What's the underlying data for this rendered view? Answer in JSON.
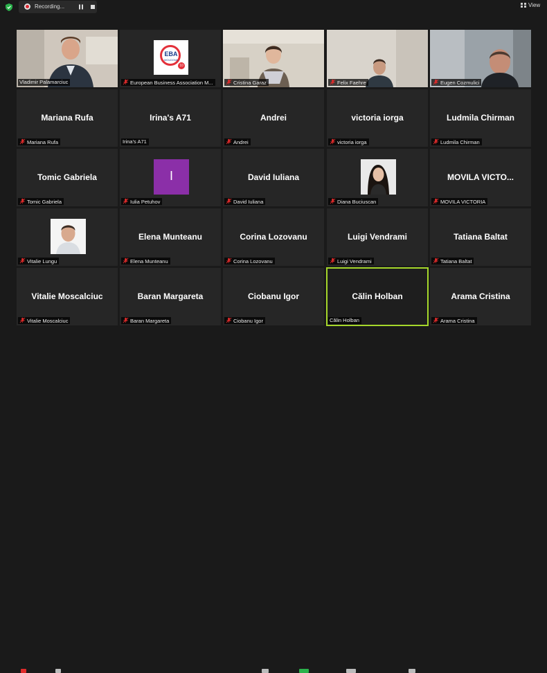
{
  "topbar": {
    "recording_label": "Recording...",
    "view_label": "View",
    "icons": [
      "security-shield-icon",
      "recording-icon",
      "pause-icon",
      "stop-icon",
      "grid-view-icon"
    ]
  },
  "colors": {
    "background": "#1a1a1a",
    "tile": "#262626",
    "active_speaker_border": "#a6d82b",
    "muted_icon": "#e02b2b",
    "security_shield": "#2bb24c",
    "avatar_purple": "#8b2fa8"
  },
  "participants": [
    {
      "display": "Vladimir Palamarciuc",
      "label": "Vladimir Palamarciuc",
      "muted": false,
      "media": "video"
    },
    {
      "display": "European Business Association M...",
      "label": "European Business Association M...",
      "muted": true,
      "media": "logo",
      "logo_text": "EBA",
      "logo_sub": "MOLDOVA",
      "logo_badge": "10"
    },
    {
      "display": "Cristina Garaz",
      "label": "Cristina Garaz",
      "muted": true,
      "media": "video"
    },
    {
      "display": "Felix Faehre",
      "label": "Felix Faehre",
      "muted": true,
      "media": "video"
    },
    {
      "display": "Eugen Cozmulici",
      "label": "Eugen Cozmulici",
      "muted": true,
      "media": "video"
    },
    {
      "display": "Mariana Rufa",
      "label": "Mariana Rufa",
      "muted": true,
      "media": "name"
    },
    {
      "display": "Irina's A71",
      "label": "Irina's A71",
      "muted": false,
      "media": "name"
    },
    {
      "display": "Andrei",
      "label": "Andrei",
      "muted": true,
      "media": "name"
    },
    {
      "display": "victoria iorga",
      "label": "victoria iorga",
      "muted": true,
      "media": "name"
    },
    {
      "display": "Ludmila Chirman",
      "label": "Ludmila Chirman",
      "muted": true,
      "media": "name"
    },
    {
      "display": "Tomic Gabriela",
      "label": "Tomic Gabriela",
      "muted": true,
      "media": "name"
    },
    {
      "display": "I",
      "label": "Iulia Petuhov",
      "muted": true,
      "media": "avatar"
    },
    {
      "display": "David Iuliana",
      "label": "David Iuliana",
      "muted": true,
      "media": "name"
    },
    {
      "display": "Diana Buciuscan",
      "label": "Diana Buciuscan",
      "muted": true,
      "media": "photo"
    },
    {
      "display": "MOVILA  VICTO...",
      "label": "MOVILA VICTORIA",
      "muted": true,
      "media": "name"
    },
    {
      "display": "Vitalie Lungu",
      "label": "Vitalie Lungu",
      "muted": true,
      "media": "photo"
    },
    {
      "display": "Elena Munteanu",
      "label": "Elena Munteanu",
      "muted": true,
      "media": "name"
    },
    {
      "display": "Corina Lozovanu",
      "label": "Corina Lozovanu",
      "muted": true,
      "media": "name"
    },
    {
      "display": "Luigi Vendrami",
      "label": "Luigi Vendrami",
      "muted": true,
      "media": "name"
    },
    {
      "display": "Tatiana Baltat",
      "label": "Tatiana Baltat",
      "muted": true,
      "media": "name"
    },
    {
      "display": "Vitalie Moscalciuc",
      "label": "Vitalie Moscalciuc",
      "muted": true,
      "media": "name"
    },
    {
      "display": "Baran Margareta",
      "label": "Baran Margareta",
      "muted": true,
      "media": "name"
    },
    {
      "display": "Ciobanu Igor",
      "label": "Ciobanu Igor",
      "muted": true,
      "media": "name"
    },
    {
      "display": "Călin Holban",
      "label": "Călin Holban",
      "muted": false,
      "media": "name",
      "active": true
    },
    {
      "display": "Arama Cristina",
      "label": "Arama Cristina",
      "muted": true,
      "media": "name"
    }
  ]
}
